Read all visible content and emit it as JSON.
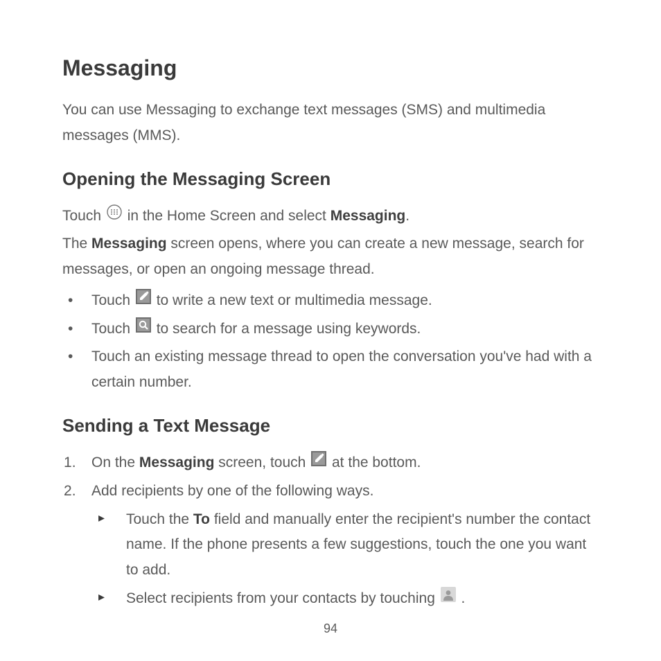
{
  "title": "Messaging",
  "intro": "You can use Messaging to exchange text messages (SMS) and multimedia messages (MMS).",
  "section1": {
    "heading": "Opening the Messaging Screen",
    "p1_a": "Touch ",
    "p1_b": " in the Home Screen and select ",
    "p1_bold": "Messaging",
    "p1_c": ".",
    "p2_a": "The ",
    "p2_bold": "Messaging",
    "p2_b": " screen opens, where you can create a new message, search for messages, or open an ongoing message thread.",
    "bullets": {
      "b1_a": "Touch ",
      "b1_b": " to write a new text or multimedia message.",
      "b2_a": "Touch ",
      "b2_b": " to search for a message using keywords.",
      "b3": "Touch an existing message thread to open the conversation you've had with a certain number."
    }
  },
  "section2": {
    "heading": "Sending a Text Message",
    "s1_a": "On the ",
    "s1_bold": "Messaging",
    "s1_b": " screen, touch ",
    "s1_c": " at the bottom.",
    "s2": "Add recipients by one of the following ways.",
    "sub": {
      "t1_a": "Touch the ",
      "t1_bold": "To",
      "t1_b": " field and manually enter the recipient's number the contact name. If the phone presents a few suggestions, touch the one you want to add.",
      "t2_a": "Select recipients from your contacts by touching ",
      "t2_b": " ."
    }
  },
  "page_number": "94"
}
